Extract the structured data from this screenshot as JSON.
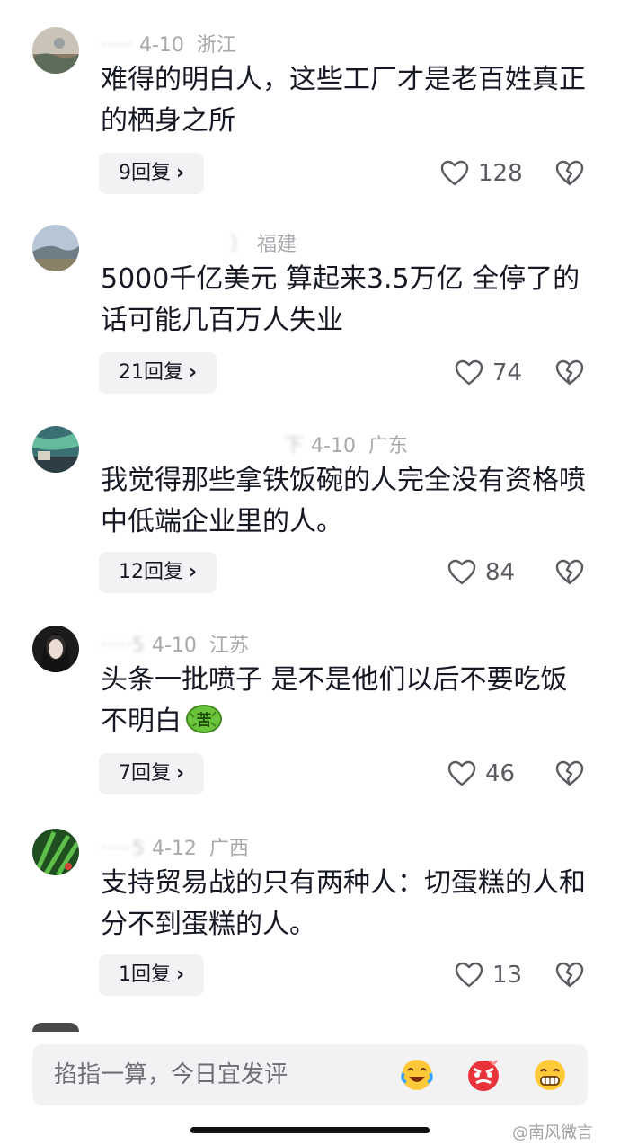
{
  "comments": [
    {
      "username": "·····",
      "date": "4-10",
      "location": "浙江",
      "text": "难得的明白人，这些工厂才是老百姓真正的栖身之所",
      "reply_label": "9回复",
      "likes": "128"
    },
    {
      "username": "）",
      "date": "",
      "location": "福建",
      "text": "5000千亿美元 算起来3.5万亿 全停了的话可能几百万人失业",
      "reply_label": "21回复",
      "likes": "74"
    },
    {
      "username": "下",
      "date": "4-10",
      "location": "广东",
      "text": "我觉得那些拿铁饭碗的人完全没有资格喷中低端企业里的人。",
      "reply_label": "12回复",
      "likes": "84"
    },
    {
      "username": "·····5",
      "date": "4-10",
      "location": "江苏",
      "text": "头条一批喷子 是不是他们以后不要吃饭 不明白",
      "emoji_text": "苦",
      "reply_label": "7回复",
      "likes": "46"
    },
    {
      "username": "·····5",
      "date": "4-12",
      "location": "广西",
      "text": "支持贸易战的只有两种人：切蛋糕的人和分不到蛋糕的人。",
      "reply_label": "1回复",
      "likes": "13"
    }
  ],
  "input": {
    "placeholder": "掐指一算，今日宜发评"
  },
  "emoji_bar": [
    "laughing-crying-emoji",
    "angry-emoji",
    "grinning-emoji"
  ],
  "watermark": "@南风微言",
  "colors": {
    "text_primary": "#161823",
    "meta_gray": "#a8a9ad",
    "button_bg": "#f2f2f4"
  }
}
